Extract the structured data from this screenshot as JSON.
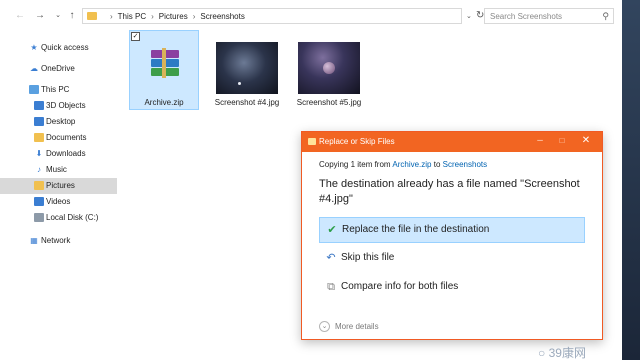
{
  "address_bar": {
    "crumbs": [
      "This PC",
      "Pictures",
      "Screenshots"
    ],
    "search_placeholder": "Search Screenshots"
  },
  "sidebar": {
    "items": [
      {
        "label": "Quick access",
        "icon": "star-icon"
      },
      {
        "label": "OneDrive",
        "icon": "cloud-icon"
      },
      {
        "label": "This PC",
        "icon": "computer-icon"
      },
      {
        "label": "3D Objects",
        "icon": "folder-icon"
      },
      {
        "label": "Desktop",
        "icon": "folder-icon"
      },
      {
        "label": "Documents",
        "icon": "folder-icon"
      },
      {
        "label": "Downloads",
        "icon": "download-folder-icon"
      },
      {
        "label": "Music",
        "icon": "music-folder-icon"
      },
      {
        "label": "Pictures",
        "icon": "folder-icon",
        "selected": true
      },
      {
        "label": "Videos",
        "icon": "folder-icon"
      },
      {
        "label": "Local Disk (C:)",
        "icon": "disk-icon"
      },
      {
        "label": "Network",
        "icon": "network-icon"
      }
    ]
  },
  "files": [
    {
      "name": "Archive.zip",
      "selected": true
    },
    {
      "name": "Screenshot #4.jpg"
    },
    {
      "name": "Screenshot #5.jpg"
    }
  ],
  "dialog": {
    "title": "Replace or Skip Files",
    "copy_prefix": "Copying 1 item from",
    "copy_source": "Archive.zip",
    "copy_mid": "to",
    "copy_dest": "Screenshots",
    "headline": "The destination already has a file named \"Screenshot #4.jpg\"",
    "options": [
      {
        "label": "Replace the file in the destination",
        "highlighted": true
      },
      {
        "label": "Skip this file"
      },
      {
        "label": "Compare info for both files"
      }
    ],
    "more_details": "More details"
  },
  "watermark": "39康网",
  "colors": {
    "dialog_accent": "#f26522",
    "selection": "#cde8ff",
    "link": "#0063b1"
  }
}
